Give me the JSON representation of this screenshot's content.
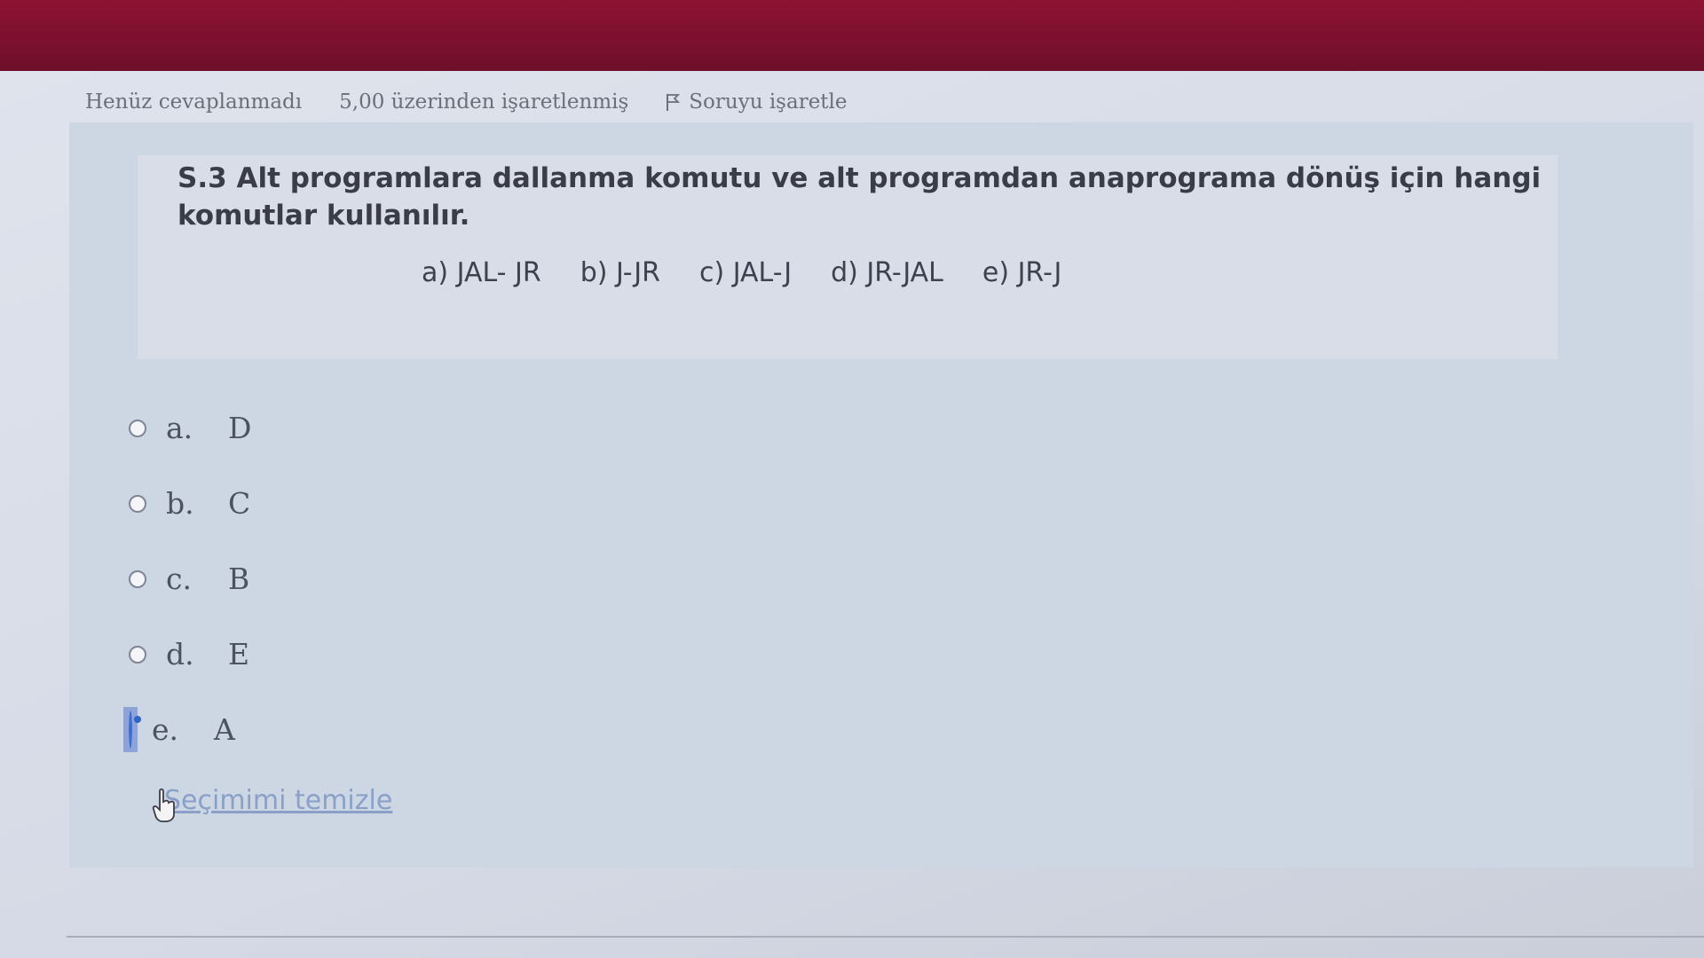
{
  "status": {
    "answer_state": "Henüz cevaplanmadı",
    "points": "5,00 üzerinden işaretlenmiş",
    "flag_label": "Soruyu işaretle"
  },
  "question": {
    "title": "S.3 Alt programlara dallanma komutu ve alt programdan anaprograma dönüş için hangi komutlar kullanılır.",
    "options": [
      "a) JAL- JR",
      "b) J-JR",
      "c) JAL-J",
      "d) JR-JAL",
      "e) JR-J"
    ]
  },
  "answers": [
    {
      "letter": "a.",
      "text": "D",
      "selected": false
    },
    {
      "letter": "b.",
      "text": "C",
      "selected": false
    },
    {
      "letter": "c.",
      "text": "B",
      "selected": false
    },
    {
      "letter": "d.",
      "text": "E",
      "selected": false
    },
    {
      "letter": "e.",
      "text": "A",
      "selected": true
    }
  ],
  "clear_label": "Seçimimi temizle",
  "colors": {
    "header": "#8e1233",
    "link": "#8aa0c8",
    "radio_checked": "#2f63c8"
  }
}
